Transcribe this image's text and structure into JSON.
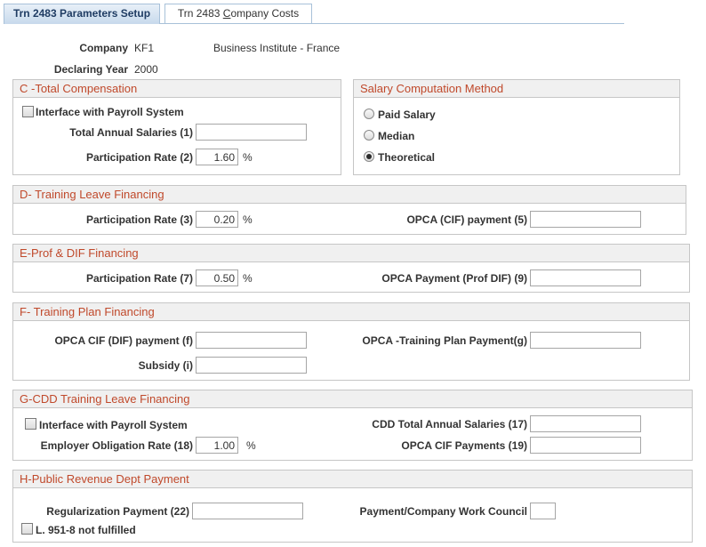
{
  "tabs": {
    "active": "Trn 2483 Parameters Setup",
    "inactive_pre": "Trn 2483 ",
    "inactive_underlined": "C",
    "inactive_post": "ompany Costs"
  },
  "header": {
    "company_label": "Company",
    "company_code": "KF1",
    "company_name": "Business Institute - France",
    "year_label": "Declaring Year",
    "year_value": "2000"
  },
  "section_c": {
    "title": "C -Total Compensation",
    "interface_label": "Interface with Payroll System",
    "salaries_label": "Total Annual Salaries (1)",
    "salaries_value": "",
    "rate_label": "Participation Rate (2)",
    "rate_value": "1.60",
    "unit": "%"
  },
  "salary_method": {
    "title": "Salary Computation Method",
    "options": [
      "Paid Salary",
      "Median",
      "Theoretical"
    ],
    "selected": "Theoretical"
  },
  "section_d": {
    "title": "D- Training Leave Financing",
    "rate_label": "Participation Rate (3)",
    "rate_value": "0.20",
    "unit": "%",
    "opca_label": "OPCA (CIF) payment (5)",
    "opca_value": ""
  },
  "section_e": {
    "title": "E-Prof & DIF Financing",
    "rate_label": "Participation Rate (7)",
    "rate_value": "0.50",
    "unit": "%",
    "opca_label": "OPCA Payment (Prof DIF) (9)",
    "opca_value": ""
  },
  "section_f": {
    "title": "F- Training Plan Financing",
    "cif_label": "OPCA CIF (DIF) payment (f)",
    "cif_value": "",
    "plan_label": "OPCA -Training Plan Payment(g)",
    "plan_value": "",
    "subsidy_label": "Subsidy (i)",
    "subsidy_value": ""
  },
  "section_g": {
    "title": "G-CDD Training Leave Financing",
    "interface_label": "Interface with Payroll System",
    "obligation_label": "Employer Obligation Rate (18)",
    "obligation_value": "1.00",
    "unit": "%",
    "cdd_label": "CDD Total Annual Salaries (17)",
    "cdd_value": "",
    "cif_label": "OPCA CIF Payments (19)",
    "cif_value": ""
  },
  "section_h": {
    "title": "H-Public Revenue Dept Payment",
    "regularization_label": "Regularization Payment (22)",
    "regularization_value": "",
    "council_label": "Payment/Company Work Council",
    "council_value": "",
    "l951_label": "L. 951-8 not fulfilled"
  }
}
